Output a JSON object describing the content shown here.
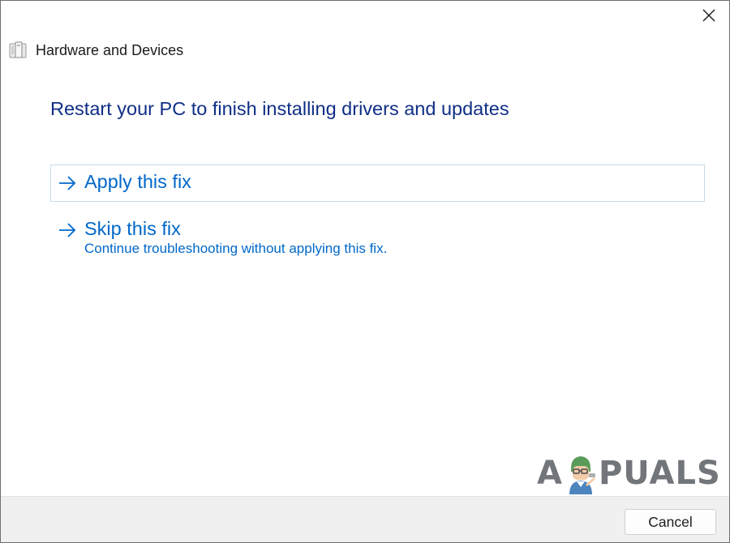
{
  "window": {
    "title": "Hardware and Devices",
    "app_icon": "hardware-devices-icon"
  },
  "main": {
    "heading": "Restart your PC to finish installing drivers and updates",
    "options": [
      {
        "icon": "arrow-right-icon",
        "label": "Apply this fix",
        "description": ""
      },
      {
        "icon": "arrow-right-icon",
        "label": "Skip this fix",
        "description": "Continue troubleshooting without applying this fix."
      }
    ]
  },
  "footer": {
    "cancel_label": "Cancel"
  },
  "watermark": {
    "text_before": "A",
    "text_after": "PUALS",
    "icon": "appuals-mascot-icon"
  },
  "colors": {
    "heading": "#0f2f86",
    "link": "#0068c9",
    "selected_border": "#c5dde6",
    "footer_bg": "#f0f0f0"
  }
}
